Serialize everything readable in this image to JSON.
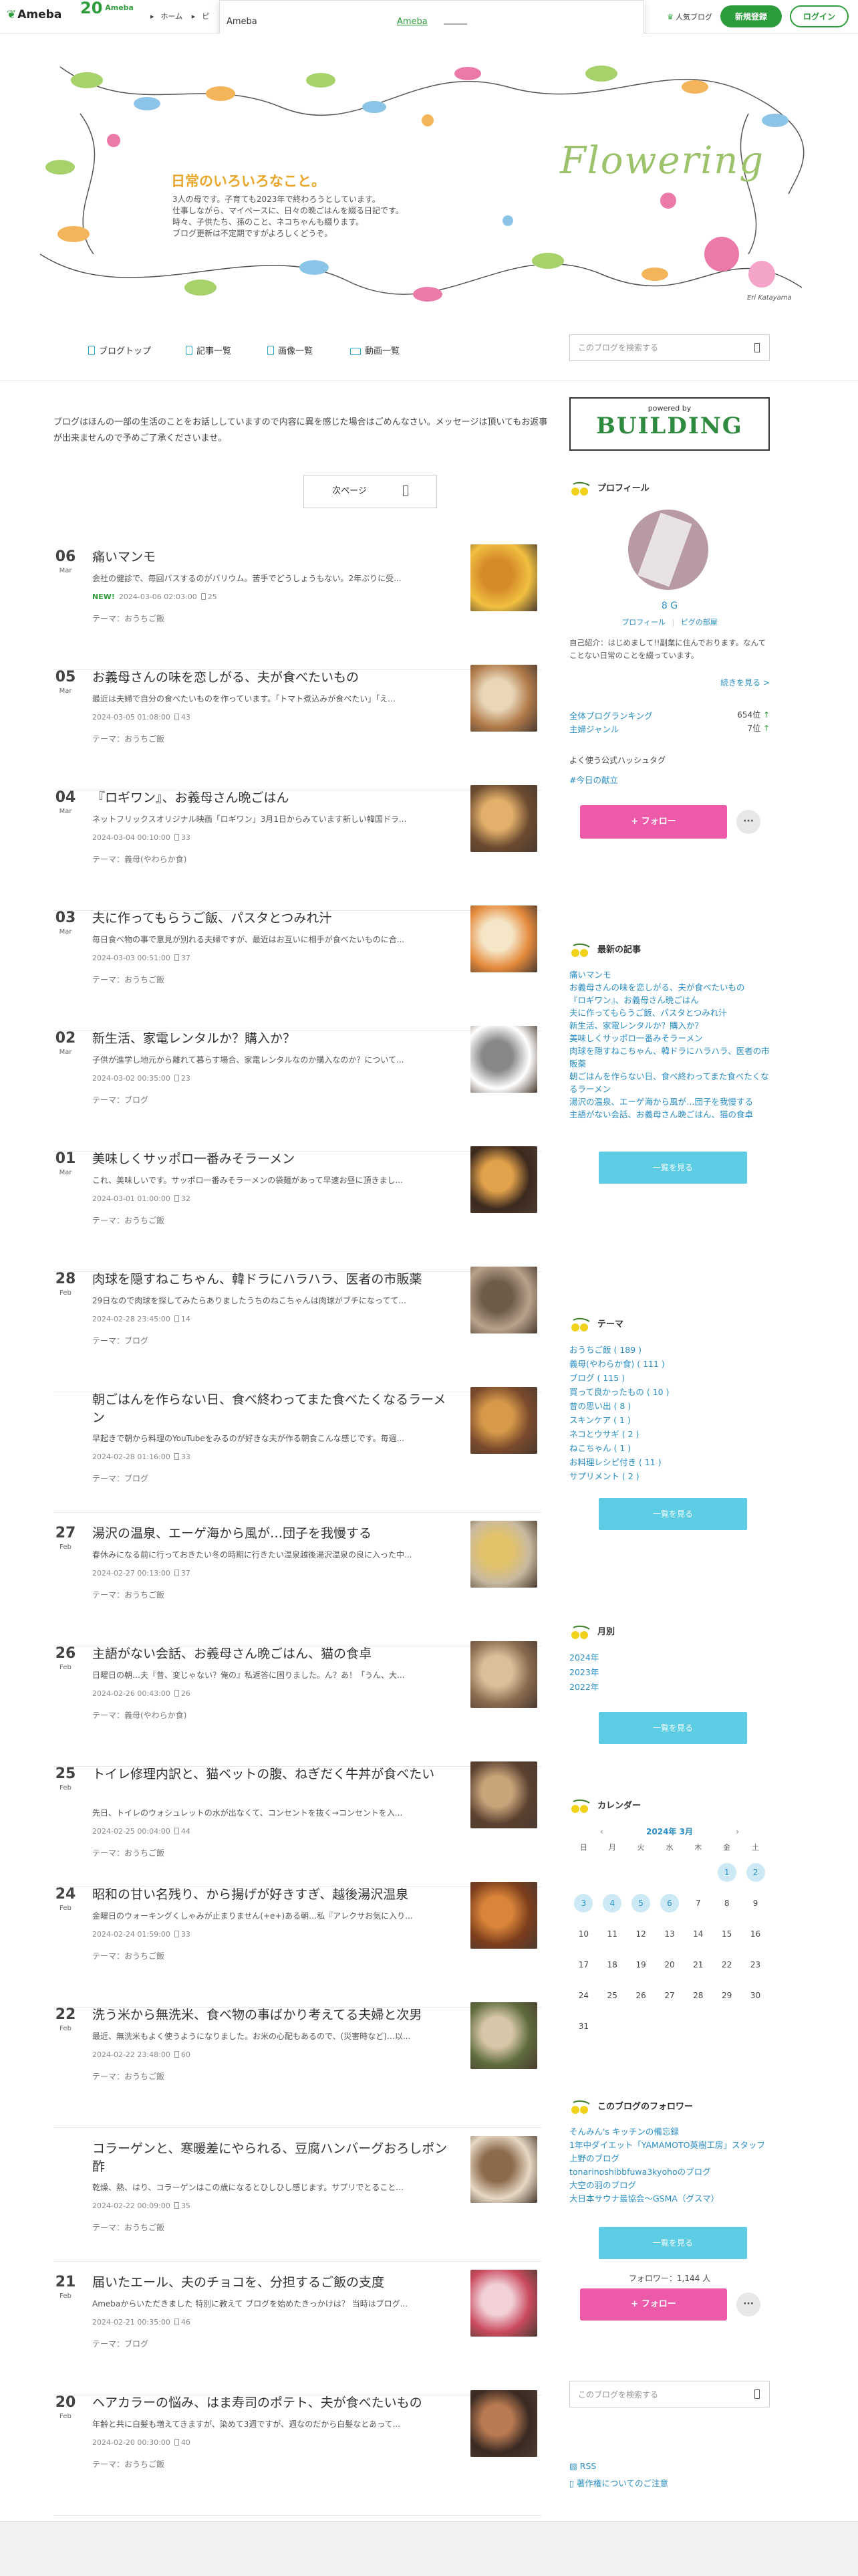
{
  "header": {
    "logo": "Ameba",
    "anniversary": {
      "num": "20",
      "brand": "Ameba",
      "sub": "20th Anniv."
    },
    "breadcrumb": [
      "ホーム",
      "ピ"
    ],
    "popular": "人気ブログ",
    "signup": "新規登録",
    "login": "ログイン"
  },
  "popup": {
    "brand": "Ameba",
    "link": "Ameba"
  },
  "banner": {
    "title": "日常のいろいろなこと。",
    "desc": [
      "3人の母です。子育ても2023年で終わろうとしています。",
      "仕事しながら、マイペースに、日々の晩ごはんを綴る日記です。",
      "時々、子供たち、孫のこと、ネコちゃんも綴ります。",
      "ブログ更新は不定期ですがよろしくどうぞ。"
    ],
    "logo_text": "Flowering",
    "signature": "Eri Katayama"
  },
  "nav": {
    "items": [
      "ブログトップ",
      "記事一覧",
      "画像一覧",
      "動画一覧"
    ],
    "search_placeholder": "このブログを検索する"
  },
  "main": {
    "notice": "ブログはほんの一部の生活のことをお話ししていますので内容に異を感じた場合はごめんなさい。メッセージは頂いてもお返事が出来ませんので予めご了承くださいませ。",
    "next_page": "次ページ",
    "entries": [
      {
        "day": "06",
        "mon": "Mar",
        "title": "痛いマンモ",
        "excerpt": "会社の健診で、毎回バスするのがバリウム。苦手でどうしょうもない。2年ぶりに受...",
        "date": "2024-03-06 02:03:00",
        "comments": "25",
        "new": "NEW!",
        "theme": "テーマ：おうちご飯"
      },
      {
        "day": "05",
        "mon": "Mar",
        "title": "お義母さんの味を恋しがる、夫が食べたいもの",
        "excerpt": "最近は夫婦で自分の食べたいものを作っています。「トマト煮込みが食べたい」「え...",
        "date": "2024-03-05 01:08:00",
        "comments": "43",
        "theme": "テーマ：おうちご飯"
      },
      {
        "day": "04",
        "mon": "Mar",
        "title": "『ロギワン』、お義母さん晩ごはん",
        "excerpt": "ネットフリックスオリジナル映画「ロギワン」3月1日からみています新しい韓国ドラ...",
        "date": "2024-03-04 00:10:00",
        "comments": "33",
        "theme": "テーマ：義母(やわらか食)"
      },
      {
        "day": "03",
        "mon": "Mar",
        "title": "夫に作ってもらうご飯、パスタとつみれ汁",
        "excerpt": "毎日食べ物の事で意見が別れる夫婦ですが、最近はお互いに相手が食べたいものに合...",
        "date": "2024-03-03 00:51:00",
        "comments": "37",
        "theme": "テーマ：おうちご飯"
      },
      {
        "day": "02",
        "mon": "Mar",
        "title": "新生活、家電レンタルか？購入か？",
        "excerpt": "子供が進学し地元から離れて暮らす場合、家電レンタルなのか購入なのか？について...",
        "date": "2024-03-02 00:35:00",
        "comments": "23",
        "theme": "テーマ：ブログ"
      },
      {
        "day": "01",
        "mon": "Mar",
        "title": "美味しくサッポロ一番みそラーメン",
        "excerpt": "これ、美味しいです。サッポロ一番みそラーメンの袋麺があって早速お昼に頂きまし...",
        "date": "2024-03-01 01:00:00",
        "comments": "32",
        "theme": "テーマ：おうちご飯"
      },
      {
        "day": "28",
        "mon": "Feb",
        "title": "肉球を隠すねこちゃん、韓ドラにハラハラ、医者の市販薬",
        "excerpt": "29日なので肉球を探してみたらありましたうちのねこちゃんは肉球がブチになってて...",
        "date": "2024-02-28 23:45:00",
        "comments": "14",
        "theme": "テーマ：ブログ"
      },
      {
        "day": "",
        "mon": "",
        "title": "朝ごはんを作らない日、食べ終わってまた食べたくなるラーメン",
        "excerpt": "早起きで朝から料理のYouTubeをみるのが好きな夫が作る朝食こんな感じです。毎週...",
        "date": "2024-02-28 01:16:00",
        "comments": "33",
        "theme": "テーマ：ブログ"
      },
      {
        "day": "27",
        "mon": "Feb",
        "title": "湯沢の温泉、エーゲ海から風が…団子を我慢する",
        "excerpt": "春休みになる前に行っておきたい冬の時期に行きたい温泉越後湯沢温泉の良に入った中...",
        "date": "2024-02-27 00:13:00",
        "comments": "37",
        "theme": "テーマ：おうちご飯"
      },
      {
        "day": "26",
        "mon": "Feb",
        "title": "主語がない会話、お義母さん晩ごはん、猫の食卓",
        "excerpt": "日曜日の朝…夫『昔、変じゃない？俺の』私返答に困りました。ん？あ！「うん、大...",
        "date": "2024-02-26 00:43:00",
        "comments": "26",
        "theme": "テーマ：義母(やわらか食)"
      },
      {
        "day": "25",
        "mon": "Feb",
        "title": "トイレ修理内訳と、猫ベットの腹、ねぎだく牛丼が食べたい",
        "excerpt": "先日、トイレのウォシュレットの水が出なくて、コンセントを抜く→コンセントを入...",
        "date": "2024-02-25 00:04:00",
        "comments": "44",
        "theme": "テーマ：おうちご飯"
      },
      {
        "day": "24",
        "mon": "Feb",
        "title": "昭和の甘い名残り、から揚げが好きすぎ、越後湯沢温泉",
        "excerpt": "金曜日のウォーキングくしゃみが止まりません(+e+)ある朝…私『アレクサお気に入り...",
        "date": "2024-02-24 01:59:00",
        "comments": "33",
        "theme": "テーマ：おうちご飯"
      },
      {
        "day": "22",
        "mon": "Feb",
        "title": "洗う米から無洗米、食べ物の事ばかり考えてる夫婦と次男",
        "excerpt": "最近、無洗米もよく使うようになりました。お米の心配もあるので、(災害時など)…以...",
        "date": "2024-02-22 23:48:00",
        "comments": "60",
        "theme": "テーマ：おうちご飯"
      },
      {
        "day": "",
        "mon": "",
        "title": "コラーゲンと、寒暖差にやられる、豆腐ハンバーグおろしポン酢",
        "excerpt": "乾燥、熱、はり、コラーゲンはこの歳になるとひしひし感じます。サプリでとること...",
        "date": "2024-02-22 00:09:00",
        "comments": "35",
        "theme": "テーマ：おうちご飯"
      },
      {
        "day": "21",
        "mon": "Feb",
        "title": "届いたエール、夫のチョコを、分担するご飯の支度",
        "excerpt": "Amebaからいただきました 特別に教えて ブログを始めたきっかけは？ 当時はブログ...",
        "date": "2024-02-21 00:35:00",
        "comments": "46",
        "theme": "テーマ：ブログ"
      },
      {
        "day": "20",
        "mon": "Feb",
        "title": "ヘアカラーの悩み、はま寿司のポテト、夫が食べたいもの",
        "excerpt": "年齢と共に白髪も増えてきますが、染めて3週ですが、週なのだから白髪なとあって...",
        "date": "2024-02-20 00:30:00",
        "comments": "40",
        "theme": "テーマ：おうちご飯"
      }
    ]
  },
  "side": {
    "powered_by": "powered by",
    "building": "BUILDING",
    "profile": {
      "heading": "プロフィール",
      "name": "8 G",
      "profile_link": "プロフィール",
      "room_link": "ピグの部屋",
      "intro": "自己紹介：はじめまして!!副業に住んでおります。なんてことない日常のことを綴っています。",
      "more": "続きを見る >",
      "rank_all": "全体ブログランキング",
      "rank_all_val": "654位",
      "rank_genre": "主婦ジャンル",
      "rank_genre_val": "7位",
      "hashtag_heading": "よく使う公式ハッシュタグ",
      "hashtag": "#今日の献立",
      "follow": "+ フォロー"
    },
    "recent": {
      "heading": "最新の記事",
      "items": [
        "痛いマンモ",
        "お義母さんの味を恋しがる、夫が食べたいもの",
        "『ロギワン』、お義母さん晩ごはん",
        "夫に作ってもらうご飯、パスタとつみれ汁",
        "新生活、家電レンタルか？購入か？",
        "美味しくサッポロ一番みそラーメン",
        "肉球を隠すねこちゃん、韓ドラにハラハラ、医者の市販薬",
        "朝ごはんを作らない日、食べ終わってまた食べたくなるラーメン",
        "湯沢の温泉、エーゲ海から風が…団子を我慢する",
        "主語がない会話、お義母さん晩ごはん、猫の食卓"
      ],
      "more": "一覧を見る"
    },
    "themes": {
      "heading": "テーマ",
      "items": [
        "おうちご飯 ( 189 )",
        "義母(やわらか食) ( 111 )",
        "ブログ ( 115 )",
        "買って良かったもの ( 10 )",
        "昔の思い出 ( 8 )",
        "スキンケア ( 1 )",
        "ネコとウサギ ( 2 )",
        "ねこちゃん ( 1 )",
        "お料理レシピ付き ( 11 )",
        "サプリメント ( 2 )"
      ],
      "more": "一覧を見る"
    },
    "monthly": {
      "heading": "月別",
      "items": [
        "2024年",
        "2023年",
        "2022年"
      ],
      "more": "一覧を見る"
    },
    "calendar": {
      "heading": "カレンダー",
      "month": "2024年 3月",
      "weekdays": [
        "日",
        "月",
        "火",
        "水",
        "木",
        "金",
        "土"
      ],
      "weeks": [
        [
          "",
          "",
          "",
          "",
          "",
          "1",
          "2"
        ],
        [
          "3",
          "4",
          "5",
          "6",
          "7",
          "8",
          "9"
        ],
        [
          "10",
          "11",
          "12",
          "13",
          "14",
          "15",
          "16"
        ],
        [
          "17",
          "18",
          "19",
          "20",
          "21",
          "22",
          "23"
        ],
        [
          "24",
          "25",
          "26",
          "27",
          "28",
          "29",
          "30"
        ],
        [
          "31",
          "",
          "",
          "",
          "",
          "",
          ""
        ]
      ],
      "highlighted": [
        "1",
        "2",
        "3",
        "4",
        "5",
        "6"
      ]
    },
    "followers": {
      "heading": "このブログのフォロワー",
      "items": [
        "そんみん's キッチンの備忘録",
        "1年中ダイエット「YAMAMOTO英樹工房」スタッフ 上野のブログ",
        "tonarinoshibbfuwa3kyohoのブログ",
        "大空の羽のブログ",
        "大日本サウナ最協会〜GSMA（グスマ）"
      ],
      "more": "一覧を見る",
      "count": "フォロワー：1,144 人",
      "follow": "+ フォロー"
    },
    "search_placeholder": "このブログを検索する",
    "rss": "RSS",
    "copyright": "著作権についてのご注意"
  },
  "colors": {
    "accent": "#2d9c3c",
    "link": "#2a8ec4",
    "follow": "#ed5aa9",
    "list_button": "#5dcde6"
  }
}
